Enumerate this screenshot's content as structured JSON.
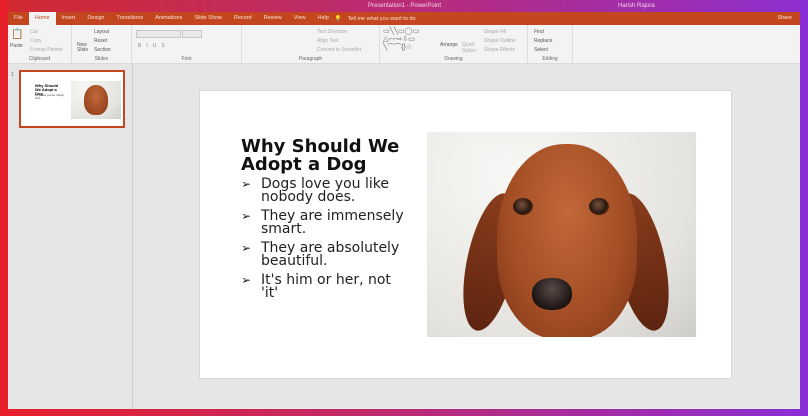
{
  "window": {
    "title": "Presentation1 - PowerPoint",
    "user": "Harish Rajora"
  },
  "tabs": [
    "File",
    "Home",
    "Insert",
    "Design",
    "Transitions",
    "Animations",
    "Slide Show",
    "Record",
    "Review",
    "View",
    "Help"
  ],
  "tell_me": "Tell me what you want to do",
  "share": "Share",
  "ribbon": {
    "clipboard": {
      "label": "Clipboard",
      "paste": "Paste",
      "cut": "Cut",
      "copy": "Copy",
      "format_painter": "Format Painter"
    },
    "slides": {
      "label": "Slides",
      "new_slide": "New Slide",
      "layout": "Layout",
      "reset": "Reset",
      "section": "Section"
    },
    "font": {
      "label": "Font"
    },
    "paragraph": {
      "label": "Paragraph",
      "text_direction": "Text Direction",
      "align_text": "Align Text",
      "smartart": "Convert to SmartArt"
    },
    "drawing": {
      "label": "Drawing",
      "arrange": "Arrange",
      "quick_styles": "Quick Styles",
      "shape_fill": "Shape Fill",
      "shape_outline": "Shape Outline",
      "shape_effects": "Shape Effects"
    },
    "editing": {
      "label": "Editing",
      "find": "Find",
      "replace": "Replace",
      "select": "Select"
    }
  },
  "thumbnail": {
    "number": "1"
  },
  "slide": {
    "title": "Why Should We Adopt a Dog",
    "bullets": [
      "Dogs love you like nobody does.",
      "They are immensely smart.",
      "They are absolutely beautiful.",
      "It's him or her, not 'it'"
    ],
    "bullet_glyph": "➢"
  }
}
